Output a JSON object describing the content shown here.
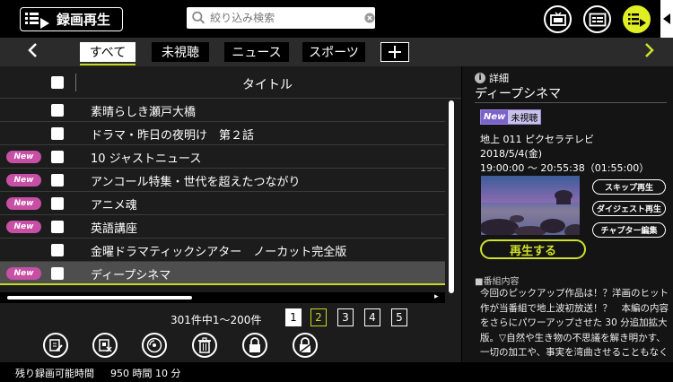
{
  "header": {
    "app_title": "録画再生",
    "search_placeholder": "絞り込み検索",
    "buttons": [
      "tv-icon",
      "guide-icon",
      "recorded-list-icon"
    ]
  },
  "tabs": {
    "items": [
      {
        "label": "すべて",
        "active": true
      },
      {
        "label": "未視聴",
        "active": false
      },
      {
        "label": "ニュース",
        "active": false
      },
      {
        "label": "スポーツ",
        "active": false
      }
    ],
    "add_label": "+"
  },
  "list": {
    "column_title": "タイトル",
    "new_badge": "New",
    "rows": [
      {
        "title": "素晴らしき瀬戸大橋",
        "new": false,
        "selected": false
      },
      {
        "title": "ドラマ・昨日の夜明け　第２話",
        "new": false,
        "selected": false
      },
      {
        "title": "10 ジャストニュース",
        "new": true,
        "selected": false
      },
      {
        "title": "アンコール特集・世代を超えたつながり",
        "new": true,
        "selected": false
      },
      {
        "title": "アニメ魂",
        "new": true,
        "selected": false
      },
      {
        "title": "英語講座",
        "new": true,
        "selected": false
      },
      {
        "title": "金曜ドラマティックシアター　ノーカット完全版",
        "new": false,
        "selected": false
      },
      {
        "title": "ディープシネマ",
        "new": true,
        "selected": true
      }
    ]
  },
  "pagination": {
    "count_text": "301件中1～200件",
    "pages": [
      "1",
      "2",
      "3",
      "4",
      "5"
    ],
    "current_page": "1"
  },
  "toolbar": {
    "tools": [
      "edit-icon",
      "delete-select-icon",
      "disc-icon",
      "trash-icon",
      "lock-icon",
      "unlock-icon"
    ]
  },
  "status": {
    "label": "残り録画可能時間",
    "value": "950 時間 10 分"
  },
  "detail": {
    "section_label": "詳細",
    "title": "ディープシネマ",
    "new_label": "New",
    "unwatched_label": "未視聴",
    "channel": "地上 011 ピクセラテレビ",
    "date": "2018/5/4(金)",
    "time": "19:00:00 ～ 20:55:38（01:55:00）",
    "skip_play": "スキップ再生",
    "digest_play": "ダイジェスト再生",
    "chapter_edit": "チャプター編集",
    "play_button": "再生する",
    "content_label": "■番組内容",
    "description": "今回のピックアップ作品は！？洋画のヒット作が当番組で地上波初放送！？　本編の内容をさらにパワーアップさせた 30 分追加拡大版。▽自然や生き物の不思議を解き明かす、一切の加工や、事実を湾曲させることもなく"
  }
}
